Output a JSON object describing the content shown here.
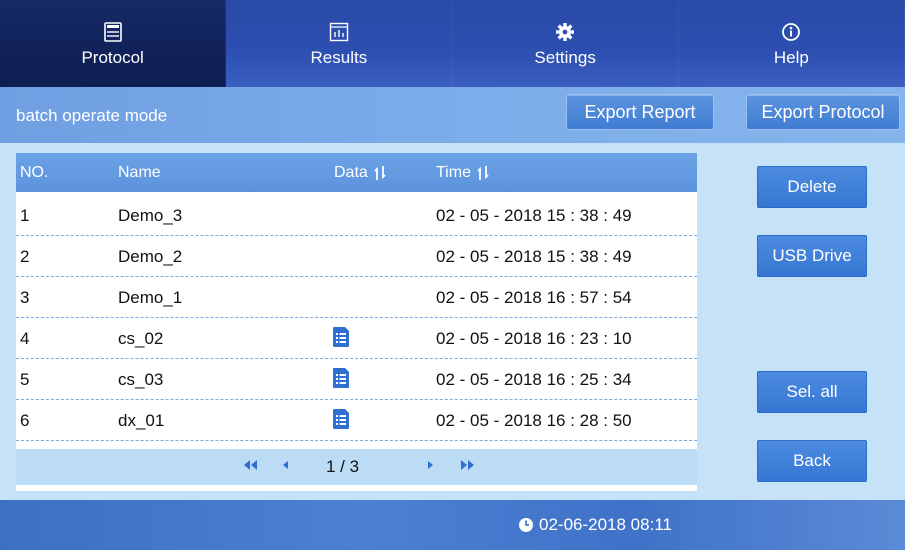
{
  "nav": {
    "tabs": [
      {
        "label": "Protocol",
        "icon": "protocol-icon",
        "active": true
      },
      {
        "label": "Results",
        "icon": "results-chart-icon",
        "active": false
      },
      {
        "label": "Settings",
        "icon": "gear-icon",
        "active": false
      },
      {
        "label": "Help",
        "icon": "info-icon",
        "active": false
      }
    ]
  },
  "header": {
    "mode_label": "batch operate mode",
    "export_report": "Export Report",
    "export_protocol": "Export Protocol"
  },
  "table": {
    "columns": [
      "NO.",
      "Name",
      "Data",
      "Time"
    ],
    "rows": [
      {
        "no": "1",
        "name": "Demo_3",
        "has_data": false,
        "time": "02 - 05 - 2018 15 : 38 : 49"
      },
      {
        "no": "2",
        "name": "Demo_2",
        "has_data": false,
        "time": "02 - 05 - 2018 15 : 38 : 49"
      },
      {
        "no": "3",
        "name": "Demo_1",
        "has_data": false,
        "time": "02 - 05 - 2018 16 : 57 : 54"
      },
      {
        "no": "4",
        "name": "cs_02",
        "has_data": true,
        "time": "02 - 05 - 2018 16 : 23 : 10"
      },
      {
        "no": "5",
        "name": "cs_03",
        "has_data": true,
        "time": "02 - 05 - 2018 16 : 25 : 34"
      },
      {
        "no": "6",
        "name": "dx_01",
        "has_data": true,
        "time": "02 - 05 - 2018 16 : 28 : 50"
      }
    ]
  },
  "pagination": {
    "text": "1 / 3"
  },
  "side_buttons": {
    "delete": "Delete",
    "usb": "USB Drive",
    "select_all": "Sel. all",
    "back": "Back"
  },
  "footer": {
    "datetime": "02-06-2018 08:11"
  },
  "colors": {
    "nav_bg": "#15245c",
    "subheader_bg": "#7eaeea",
    "table_header_bg": "#5d93dc",
    "button_bg": "#3577d3",
    "panel_bg": "#c6e2f8"
  }
}
